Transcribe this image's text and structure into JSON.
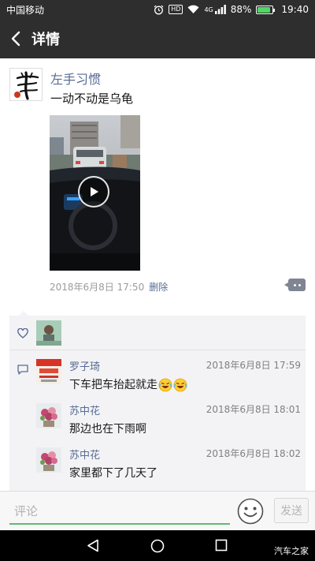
{
  "status_bar": {
    "carrier": "中国移动",
    "hd": "HD",
    "network": "4G",
    "battery": "88%",
    "battery_level": 0.88,
    "time": "19:40"
  },
  "header": {
    "title": "详情"
  },
  "post": {
    "username": "左手习惯",
    "text": "一动不动是乌龟",
    "date": "2018年6月8日 17:50",
    "delete_label": "删除"
  },
  "likes": {
    "count": 1
  },
  "comments": [
    {
      "name": "罗子琦",
      "time": "2018年6月8日 17:59",
      "text": "下车把车抬起就走",
      "emoji": [
        "laughing-crying-emoji",
        "laughing-crying-emoji"
      ]
    },
    {
      "name": "苏中花",
      "time": "2018年6月8日 18:01",
      "text": "那边也在下雨啊"
    },
    {
      "name": "苏中花",
      "time": "2018年6月8日 18:02",
      "text": "家里都下了几天了"
    }
  ],
  "comment_bar": {
    "placeholder": "评论",
    "send_label": "发送"
  },
  "watermark": "汽车之家",
  "colors": {
    "bar_bg": "#2e2e2e",
    "link": "#576b95",
    "panel_bg": "#f3f3f5",
    "input_accent": "#5fb878"
  }
}
